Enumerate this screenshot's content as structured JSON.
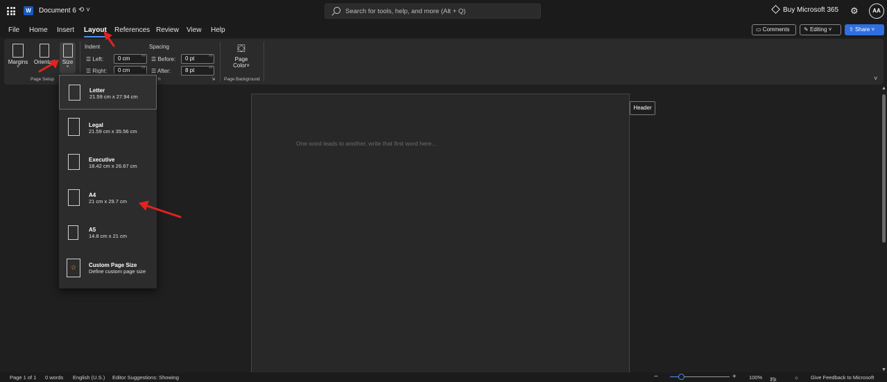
{
  "titlebar": {
    "app_logo": "W",
    "doc_title": "Document 6",
    "sync_indicator": "⟲ ˅",
    "search_placeholder": "Search for tools, help, and more (Alt + Q)",
    "buy_label": "Buy Microsoft 365",
    "avatar_initials": "AA"
  },
  "menu": {
    "tabs": [
      {
        "label": "File"
      },
      {
        "label": "Home"
      },
      {
        "label": "Insert"
      },
      {
        "label": "Layout"
      },
      {
        "label": "References"
      },
      {
        "label": "Review"
      },
      {
        "label": "View"
      },
      {
        "label": "Help"
      }
    ],
    "active_tab": "Layout",
    "comments_label": "Comments",
    "editing_label": "Editing",
    "share_label": "Share"
  },
  "ribbon": {
    "page_setup": {
      "margins_label": "Margins",
      "orientation_label": "Orientati",
      "size_label": "Size",
      "caption": "Page Setup"
    },
    "indent": {
      "title": "Indent",
      "left_label": "Left:",
      "left_value": "0 cm",
      "right_label": "Right:",
      "right_value": "0 cm"
    },
    "spacing": {
      "title": "Spacing",
      "before_label": "Before:",
      "before_value": "0 pt",
      "after_label": "After:",
      "after_value": "8 pt"
    },
    "paragraph_caption": "h",
    "page_background": {
      "page_color_line1": "Page",
      "page_color_line2": "Color",
      "caption": "Page Background"
    }
  },
  "size_menu": {
    "items": [
      {
        "name": "Letter",
        "dims": "21.59 cm x 27.94 cm"
      },
      {
        "name": "Legal",
        "dims": "21.59 cm x 35.56 cm"
      },
      {
        "name": "Executive",
        "dims": "18.42 cm x 26.67 cm"
      },
      {
        "name": "A4",
        "dims": "21 cm x 29.7 cm"
      },
      {
        "name": "A5",
        "dims": "14.8 cm x 21 cm"
      },
      {
        "name": "Custom Page Size",
        "dims": "Define custom page size"
      }
    ],
    "highlighted": "Letter"
  },
  "document": {
    "placeholder": "One word leads to another, write that first word here...",
    "header_button": "Header"
  },
  "status": {
    "page": "Page 1 of 1",
    "words": "0 words",
    "language": "English (U.S.)",
    "editor": "Editor Suggestions: Showing",
    "zoom": "100%",
    "zoom_level": 0.2,
    "fit": "Fit",
    "feedback": "Give Feedback to Microsoft"
  },
  "colors": {
    "accent": "#4c8df6",
    "share": "#2f6fe0",
    "annotation": "#e3231f"
  }
}
